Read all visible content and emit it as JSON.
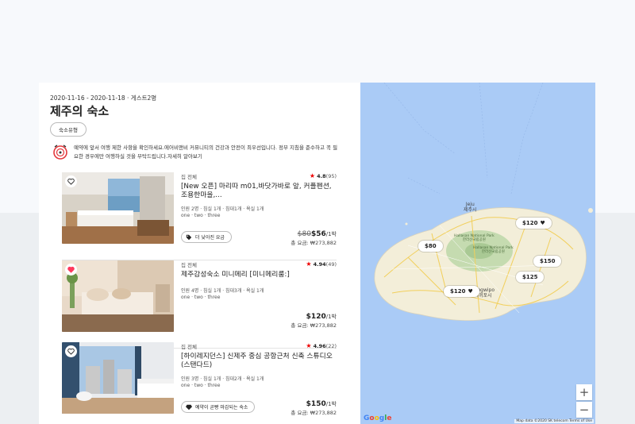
{
  "search": {
    "meta": "2020-11-16 - 2020-11-18 · 게스트2명",
    "title": "제주의 숙소",
    "filter_label": "숙소유형"
  },
  "notice": {
    "text": "예약에 앞서 여행 제한 사항을 확인하세요.에어비앤비 커뮤니티의 건강과 안전이 최우선입니다. 정부 지침을 준수하고 꼭 필요한 경우에만 여행하실 것을 부탁드립니다.자세히 알아보기"
  },
  "listings": [
    {
      "type": "집 전체",
      "rating": "4.8",
      "reviews": "(95)",
      "name": "[New 오픈] 마리따 m01,바닷가바로 앞, 커플펜션,조용한마을,...",
      "spec": "인원 2명 · 침실 1개 · 침대1개 · 욕실 1개",
      "tags": "one · two · three",
      "promo": "더 낮아진 요금",
      "old_price": "$80",
      "price": "$56",
      "per": "/1박",
      "total": "총 요금: ₩273,882",
      "favorited": false
    },
    {
      "type": "집 전체",
      "rating": "4.94",
      "reviews": "(49)",
      "name": "제주감성숙소 미니메리 [미니메리룸:]",
      "spec": "인원 4명 · 침실 1개 · 침대3개 · 욕실 1개",
      "tags": "one · two · three",
      "promo": "",
      "old_price": "",
      "price": "$120",
      "per": "/1박",
      "total": "총 요금: ₩273,882",
      "favorited": true
    },
    {
      "type": "집 전체",
      "rating": "4.96",
      "reviews": "(22)",
      "name": "[하이레지던스] 신제주 중심 공항근처 신축 스튜디오 (스탠다드)",
      "spec": "인원 3명 · 침실 1개 · 침대2개 · 욕실 1개",
      "tags": "one · two · three",
      "promo": "예약이 곧빵 마감되는 숙소",
      "old_price": "",
      "price": "$150",
      "per": "/1박",
      "total": "총 요금: ₩273,882",
      "favorited": false
    }
  ],
  "map": {
    "pins": [
      {
        "label": "$120",
        "heart": true
      },
      {
        "label": "$80",
        "heart": false
      },
      {
        "label": "$150",
        "heart": false
      },
      {
        "label": "$125",
        "heart": false
      },
      {
        "label": "$120",
        "heart": true
      }
    ],
    "labels": {
      "jeju": "Jeju\n제주시",
      "hallasan_np": "Hallasan National Park\n한라산국립공원",
      "hallasan_np2": "Hallasan National Park\n한라산국립공원",
      "seogwipo": "Seogwipo\n서귀포시"
    },
    "zoom_in": "+",
    "zoom_out": "−",
    "google": "Google",
    "attribution": "Map data ©2020 SK telecom   Terms of Use"
  },
  "colors": {
    "accent": "#ff385c",
    "star": "#e00000",
    "water": "#aacbf6",
    "land": "#f3eed9",
    "park": "#c5dbb0"
  }
}
